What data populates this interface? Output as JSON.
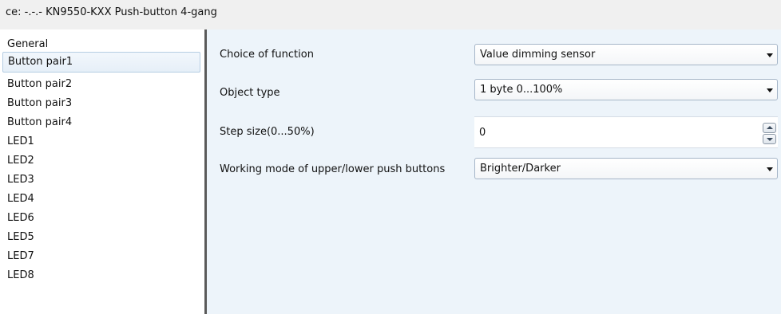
{
  "window": {
    "title": "ce: -.-.-  KN9550-KXX Push-button 4-gang"
  },
  "sidebar": {
    "items": [
      {
        "label": "General"
      },
      {
        "label": "Button pair1",
        "selected": true
      },
      {
        "label": "Button pair2"
      },
      {
        "label": "Button pair3"
      },
      {
        "label": "Button pair4"
      },
      {
        "label": "LED1"
      },
      {
        "label": "LED2"
      },
      {
        "label": "LED3"
      },
      {
        "label": "LED4"
      },
      {
        "label": "LED6"
      },
      {
        "label": "LED5"
      },
      {
        "label": "LED7"
      },
      {
        "label": "LED8"
      }
    ]
  },
  "params": {
    "choice_of_function": {
      "label": "Choice of function",
      "value": "Value dimming sensor"
    },
    "object_type": {
      "label": "Object type",
      "value": "1 byte 0...100%"
    },
    "step_size": {
      "label": "Step size(0...50%)",
      "value": "0"
    },
    "working_mode": {
      "label": "Working mode of upper/lower push buttons",
      "value": "Brighter/Darker"
    }
  },
  "icons": {
    "dropdown": "chevron-down-icon",
    "spin_up": "spin-up-icon",
    "spin_down": "spin-down-icon"
  },
  "colors": {
    "panel_bg": "#edf4fa",
    "divider": "#5a5a5a",
    "selection_border": "#b5cde3"
  }
}
